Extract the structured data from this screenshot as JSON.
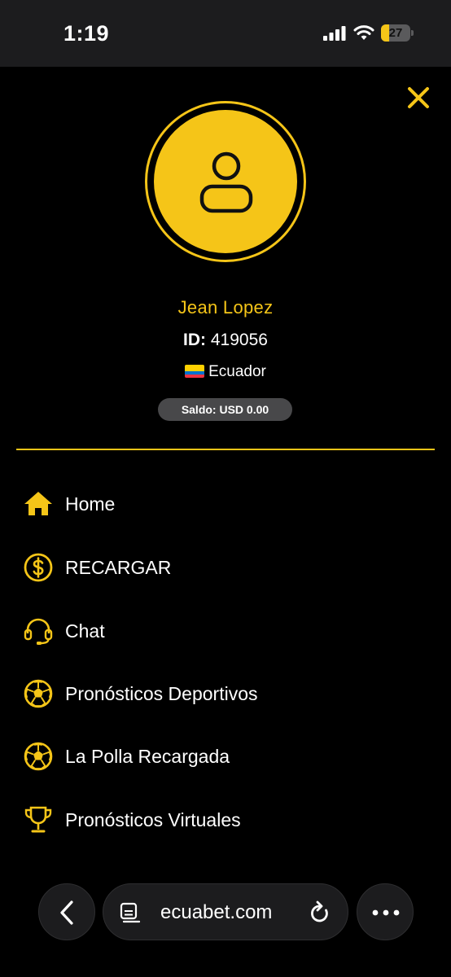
{
  "status_bar": {
    "time": "1:19",
    "battery_level": "27",
    "battery_fraction": 0.27
  },
  "profile": {
    "name": "Jean Lopez",
    "id_label": "ID:",
    "id_value": "419056",
    "country": "Ecuador",
    "balance": "Saldo: USD 0.00"
  },
  "menu": {
    "items": [
      {
        "label": "Home",
        "icon": "home-icon"
      },
      {
        "label": "RECARGAR",
        "icon": "dollar-circle-icon"
      },
      {
        "label": "Chat",
        "icon": "headset-icon"
      },
      {
        "label": "Pronósticos Deportivos",
        "icon": "soccer-ball-icon"
      },
      {
        "label": "La Polla Recargada",
        "icon": "soccer-ball-icon"
      },
      {
        "label": "Pronósticos Virtuales",
        "icon": "trophy-icon"
      }
    ]
  },
  "browser": {
    "url": "ecuabet.com"
  },
  "colors": {
    "accent": "#f5c518",
    "background": "#000000",
    "pill": "#48484a"
  }
}
